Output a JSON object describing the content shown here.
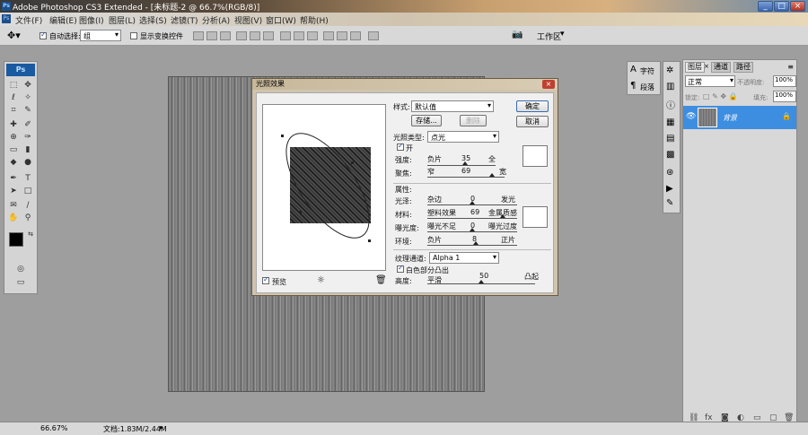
{
  "app": {
    "ps_badge": "Ps",
    "title": "Adobe Photoshop CS3 Extended - [未标题-2 @ 66.7%(RGB/8)]",
    "window_controls": [
      "_",
      "□",
      "×"
    ]
  },
  "menu": [
    "文件(F)",
    "编辑(E)",
    "图像(I)",
    "图层(L)",
    "选择(S)",
    "滤镜(T)",
    "分析(A)",
    "视图(V)",
    "窗口(W)",
    "帮助(H)"
  ],
  "options": {
    "auto_select_label": "自动选择:",
    "auto_select_value": "组",
    "show_transform_label": "显示变换控件",
    "workspace_label": "工作区"
  },
  "toolbar": {
    "ps_logo": "Ps"
  },
  "dialog": {
    "title": "光照效果",
    "close": "×",
    "style_label": "样式:",
    "style_value": "默认值",
    "save_label": "存储...",
    "delete_label": "删除",
    "ok_label": "确定",
    "cancel_label": "取消",
    "light_type_label": "光照类型:",
    "light_type_value": "点光",
    "on_label": "开",
    "intensity_label": "强度:",
    "intensity_left": "负片",
    "intensity_value": "35",
    "intensity_right": "全",
    "focus_label": "聚焦:",
    "focus_left": "窄",
    "focus_value": "69",
    "focus_right": "宽",
    "properties_label": "属性:",
    "gloss_label": "光泽:",
    "gloss_left": "杂边",
    "gloss_value": "0",
    "gloss_right": "发光",
    "material_label": "材料:",
    "material_left": "塑料效果",
    "material_value": "69",
    "material_right": "金属质感",
    "exposure_label": "曝光度:",
    "exposure_left": "曝光不足",
    "exposure_value": "0",
    "exposure_right": "曝光过度",
    "ambience_label": "环境:",
    "ambience_left": "负片",
    "ambience_value": "8",
    "ambience_right": "正片",
    "texture_label": "纹理通道:",
    "texture_value": "Alpha 1",
    "white_high_label": "白色部分凸出",
    "height_label": "高度:",
    "height_left": "平滑",
    "height_value": "50",
    "height_right": "凸起",
    "preview_label": "预览",
    "sliders": {
      "intensity": 0.55,
      "focus": 0.84,
      "gloss": 0.5,
      "material": 0.84,
      "exposure": 0.5,
      "ambience": 0.54,
      "height": 0.5
    }
  },
  "panels": {
    "char_label": "字符",
    "para_label": "段落",
    "layers_tab": "图层",
    "channels_tab": "通道",
    "paths_tab": "路径",
    "blend_mode": "正常",
    "opacity_label": "不透明度:",
    "opacity_value": "100%",
    "lock_label": "锁定:",
    "fill_label": "填充:",
    "fill_value": "100%",
    "layer_name": "背景"
  },
  "status": {
    "zoom": "66.67%",
    "doc_info": "文档:1.83M/2.44M"
  },
  "colors": {
    "layer_selected": "#3d8ee0",
    "dialog_bg": "#d0c4b0"
  }
}
